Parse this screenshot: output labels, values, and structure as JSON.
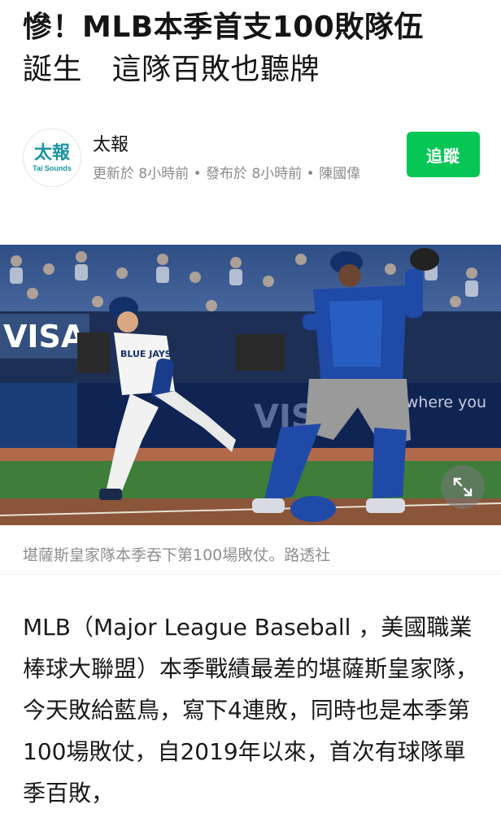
{
  "article": {
    "headline_line1": "慘！MLB本季首支100敗隊伍",
    "headline_line2": "誕生　這隊百敗也聽牌"
  },
  "source": {
    "logo_text": "太報",
    "logo_sub": "Tai Sounds",
    "name": "太報",
    "meta": "更新於 8小時前 • 發布於 8小時前 • 陳國偉",
    "follow_label": "追蹤"
  },
  "photo": {
    "sign_left": "VISA",
    "sign_right": "erywhere you",
    "sign_visa2": "VISA",
    "jersey_text": "BLUE JAYS",
    "icon": "expand-icon"
  },
  "caption": "堪薩斯皇家隊本季吞下第100場敗仗。路透社",
  "body": "MLB（Major League Baseball ，美國職業棒球大聯盟）本季戰績最差的堪薩斯皇家隊，今天敗給藍鳥，寫下4連敗，同時也是本季第100場敗仗，自2019年以來，首次有球隊單季百敗，",
  "colors": {
    "follow": "#06c755",
    "logo": "#1b95a4",
    "caption": "#8f8f8f"
  }
}
